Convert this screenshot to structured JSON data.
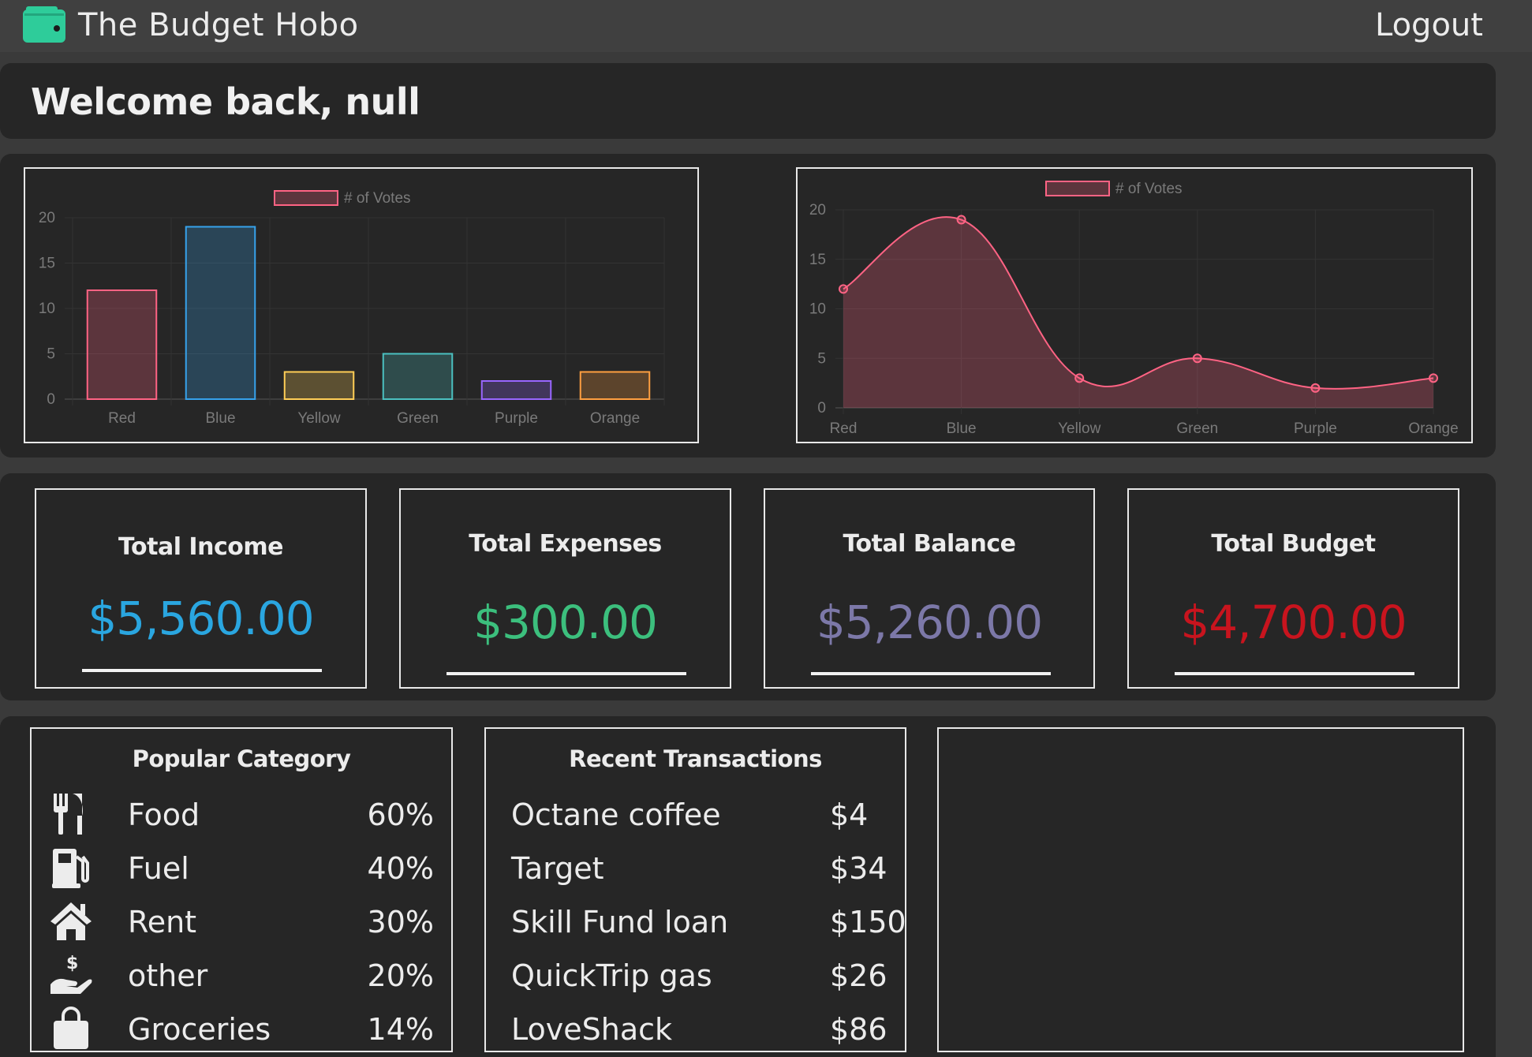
{
  "app": {
    "name": "The Budget Hobo",
    "logout_label": "Logout",
    "brand_color": "#2ecc9a"
  },
  "welcome": {
    "text": "Welcome back, null"
  },
  "charts": {
    "bar_legend": "# of Votes",
    "line_legend": "# of Votes"
  },
  "chart_data": [
    {
      "type": "bar",
      "categories": [
        "Red",
        "Blue",
        "Yellow",
        "Green",
        "Purple",
        "Orange"
      ],
      "series": [
        {
          "name": "# of Votes",
          "values": [
            12,
            19,
            3,
            5,
            2,
            3
          ]
        }
      ],
      "ylim": [
        0,
        20
      ],
      "yticks": [
        0,
        5,
        10,
        15,
        20
      ],
      "grid": true,
      "legend": "top-center",
      "colors": [
        "#ff6384",
        "#36a2eb",
        "#ffce56",
        "#4bc0c0",
        "#9966ff",
        "#ff9f40"
      ]
    },
    {
      "type": "area",
      "categories": [
        "Red",
        "Blue",
        "Yellow",
        "Green",
        "Purple",
        "Orange"
      ],
      "series": [
        {
          "name": "# of Votes",
          "values": [
            12,
            19,
            3,
            5,
            2,
            3
          ]
        }
      ],
      "ylim": [
        0,
        20
      ],
      "yticks": [
        0,
        5,
        10,
        15,
        20
      ],
      "grid": true,
      "legend": "top-center",
      "colors": [
        "#ff6384"
      ]
    }
  ],
  "stats": [
    {
      "title": "Total Income",
      "value": "$5,560.00",
      "color": "#2aa6e0"
    },
    {
      "title": "Total Expenses",
      "value": "$300.00",
      "color": "#3cbf7d"
    },
    {
      "title": "Total Balance",
      "value": "$5,260.00",
      "color": "#7c78a8"
    },
    {
      "title": "Total Budget",
      "value": "$4,700.00",
      "color": "#c8141e"
    }
  ],
  "popular": {
    "title": "Popular Category",
    "items": [
      {
        "icon": "utensils-icon",
        "name": "Food",
        "pct": "60%"
      },
      {
        "icon": "gas-pump-icon",
        "name": "Fuel",
        "pct": "40%"
      },
      {
        "icon": "home-icon",
        "name": "Rent",
        "pct": "30%"
      },
      {
        "icon": "hand-holding-dollar-icon",
        "name": "other",
        "pct": "20%"
      },
      {
        "icon": "shopping-bag-icon",
        "name": "Groceries",
        "pct": "14%"
      }
    ]
  },
  "transactions": {
    "title": "Recent Transactions",
    "items": [
      {
        "name": "Octane coffee",
        "amount": "$4"
      },
      {
        "name": "Target",
        "amount": "$34"
      },
      {
        "name": "Skill Fund loan",
        "amount": "$150"
      },
      {
        "name": "QuickTrip gas",
        "amount": "$26"
      },
      {
        "name": "LoveShack",
        "amount": "$86"
      }
    ]
  }
}
